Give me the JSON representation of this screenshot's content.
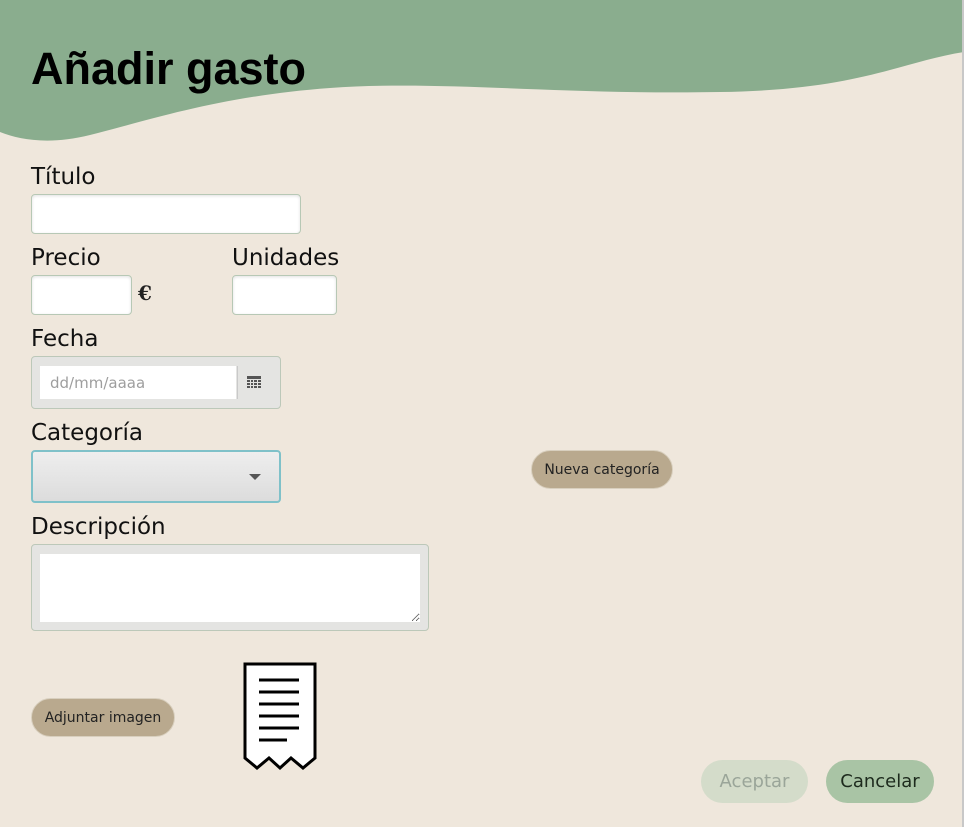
{
  "page": {
    "title": "Añadir gasto"
  },
  "form": {
    "titulo": {
      "label": "Título",
      "value": ""
    },
    "precio": {
      "label": "Precio",
      "value": "",
      "currency": "€"
    },
    "unidades": {
      "label": "Unidades",
      "value": ""
    },
    "fecha": {
      "label": "Fecha",
      "value": "",
      "placeholder": "dd/mm/aaaa"
    },
    "categoria": {
      "label": "Categoría",
      "selected": ""
    },
    "descripcion": {
      "label": "Descripción",
      "value": ""
    }
  },
  "buttons": {
    "nueva_categoria": "Nueva categoría",
    "adjuntar_imagen": "Adjuntar imagen",
    "aceptar": "Aceptar",
    "cancelar": "Cancelar"
  },
  "receipt": {
    "icon": "receipt-icon",
    "caption": ""
  },
  "colors": {
    "header": "#8aad8e",
    "background": "#efe7dc",
    "pill_button": "#b9a98e",
    "accept_disabled": "#d4dcca",
    "cancel": "#a9c4a5",
    "select_focus": "#7fc1c9"
  }
}
